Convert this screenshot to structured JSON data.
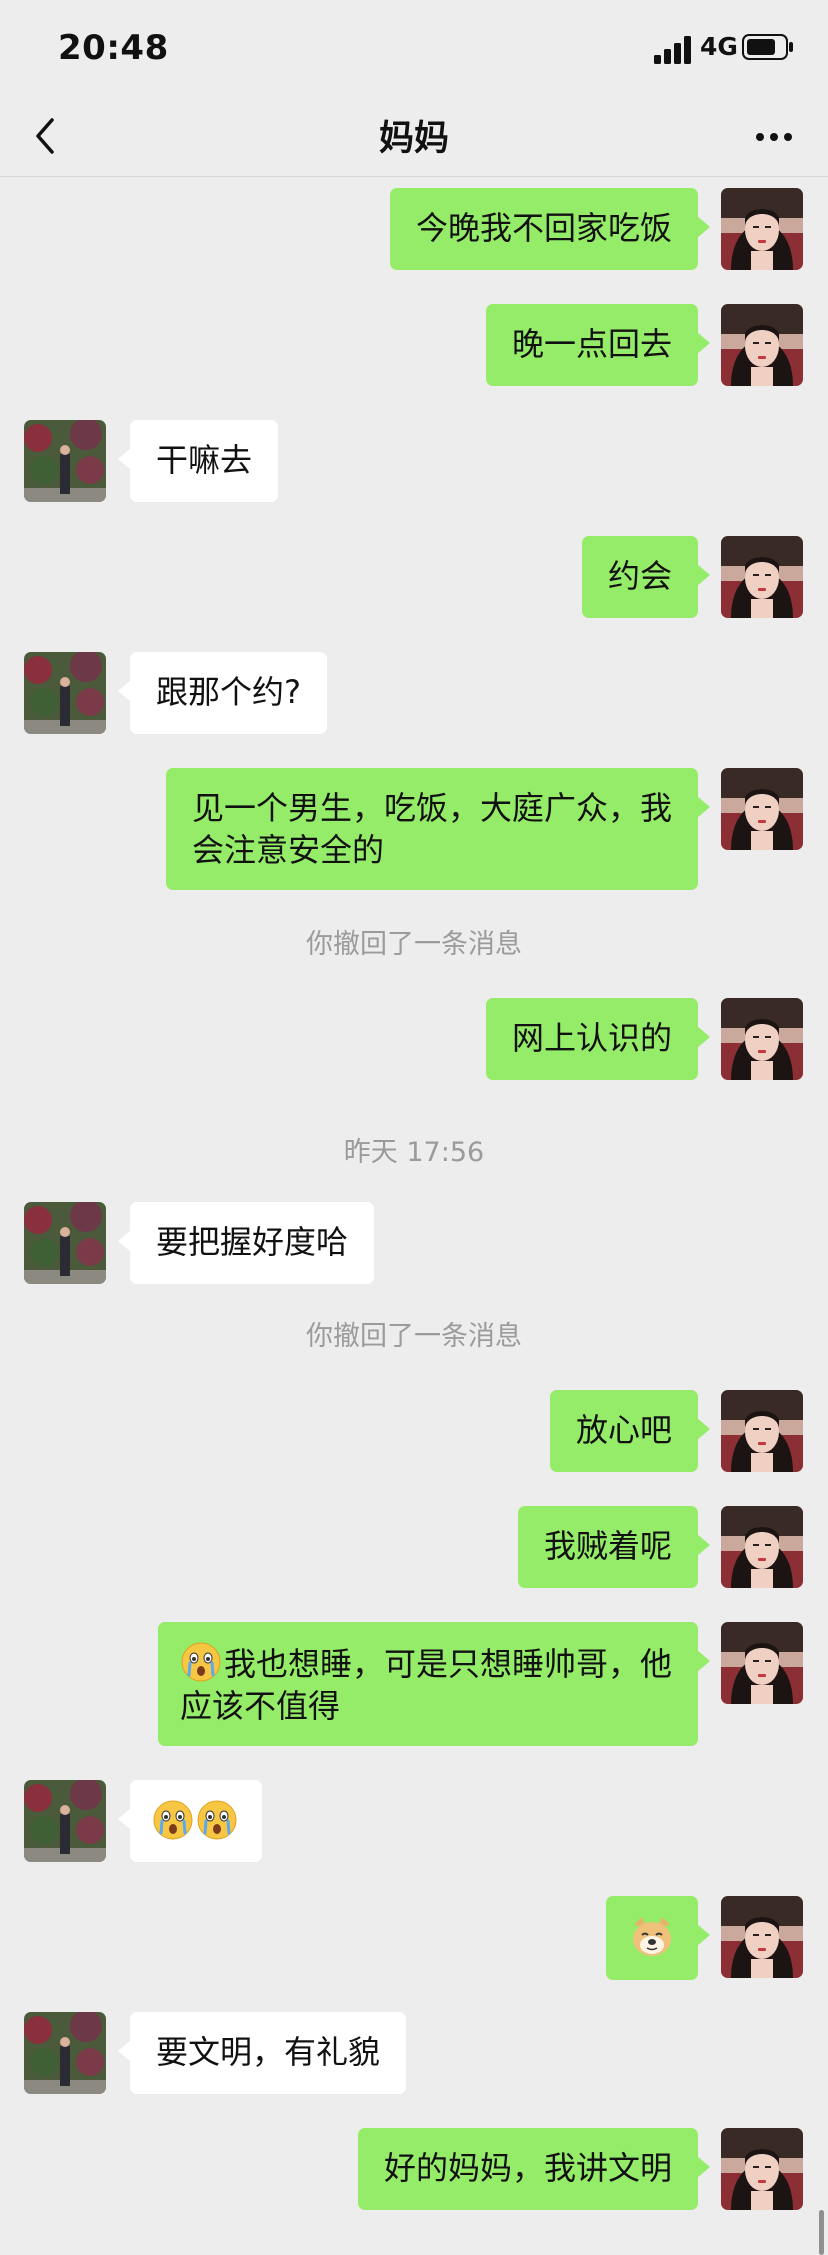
{
  "status": {
    "time": "20:48",
    "network": "4G"
  },
  "nav": {
    "title": "妈妈"
  },
  "messages": {
    "m1": "今晚我不回家吃饭",
    "m2": "晚一点回去",
    "m3": "干嘛去",
    "m4": "约会",
    "m5": "跟那个约?",
    "m6a": "见一个男生，吃饭，大庭广众，我",
    "m6b": "会注意安全的",
    "sys1": "你撤回了一条消息",
    "m7": "网上认识的",
    "ts1": "昨天 17:56",
    "m8": "要把握好度哈",
    "sys2": "你撤回了一条消息",
    "m9": "放心吧",
    "m10": "我贼着呢",
    "m11a": "我也想睡，可是只想睡帅哥，他",
    "m11b": "应该不值得",
    "m13": "要文明，有礼貌",
    "m14": "好的妈妈，我讲文明"
  },
  "icons": {
    "back": "chevron-left-icon",
    "more": "more-dots-icon",
    "emoji_shocked": "shocked-crying-emoji",
    "doge": "doge-sticker"
  },
  "colors": {
    "background": "#ededed",
    "sent_bubble": "#95ec69",
    "received_bubble": "#ffffff",
    "system_text": "#9b9b9b"
  }
}
